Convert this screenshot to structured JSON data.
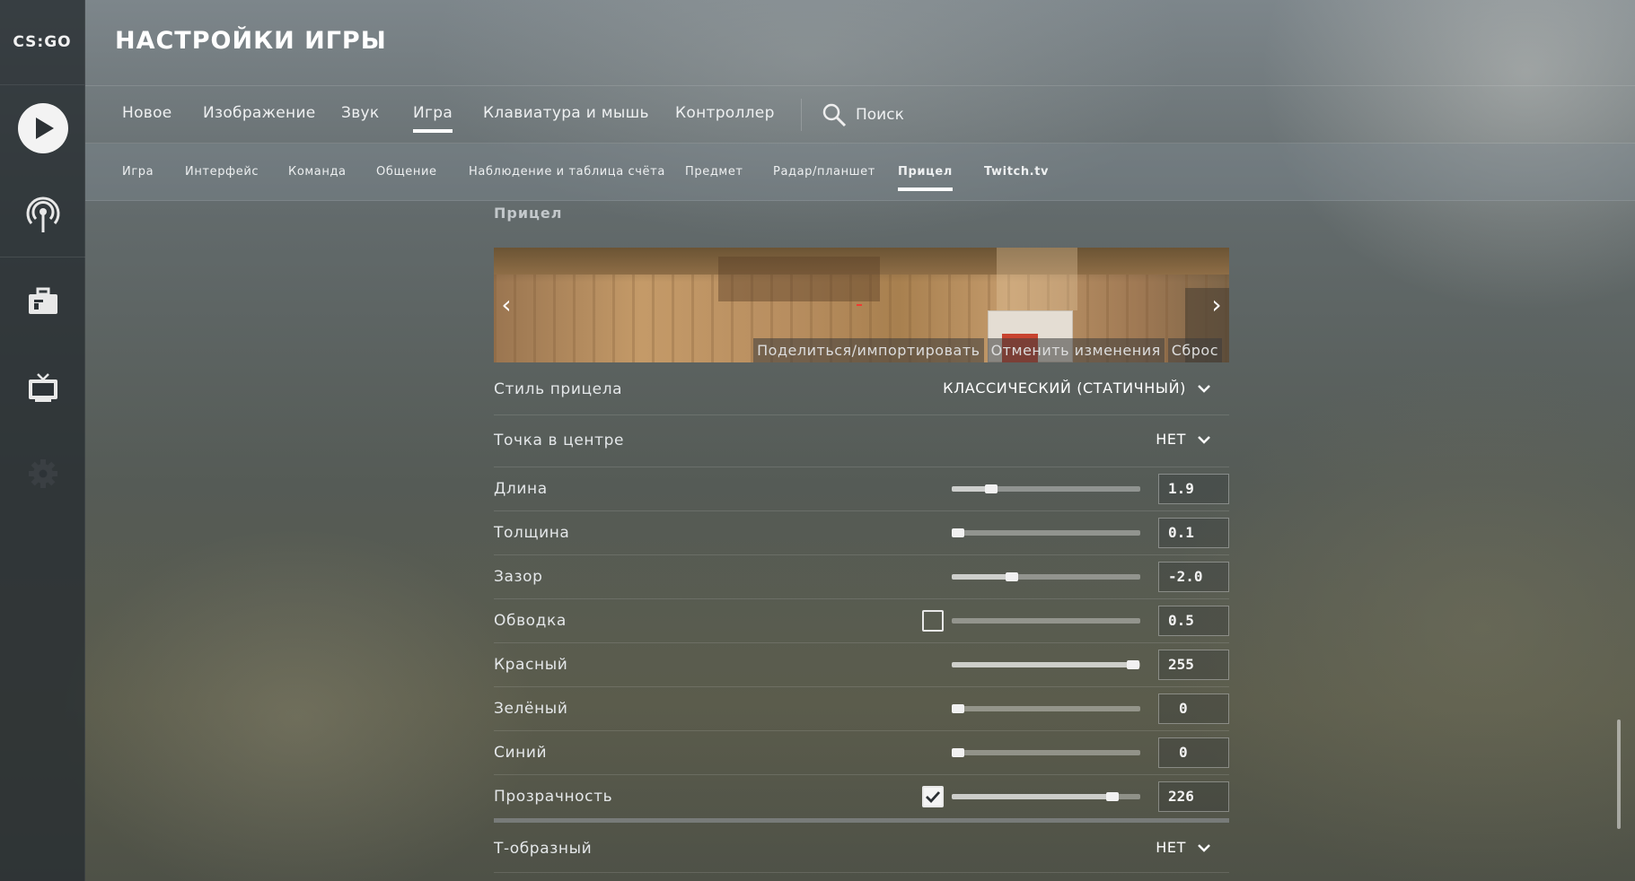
{
  "app": {
    "logo_text": "CS:GO",
    "title": "НАСТРОЙКИ ИГРЫ"
  },
  "sidebar": {
    "items": [
      {
        "name": "play",
        "icon": "play-icon"
      },
      {
        "name": "broadcast",
        "icon": "antenna-icon"
      },
      {
        "name": "inventory",
        "icon": "briefcase-icon"
      },
      {
        "name": "watch",
        "icon": "tv-icon"
      },
      {
        "name": "settings",
        "icon": "gear-icon"
      }
    ]
  },
  "main_tabs": [
    {
      "label": "Новое"
    },
    {
      "label": "Изображение"
    },
    {
      "label": "Звук"
    },
    {
      "label": "Игра",
      "active": true
    },
    {
      "label": "Клавиатура и мышь"
    },
    {
      "label": "Контроллер"
    }
  ],
  "search": {
    "label": "Поиск",
    "icon": "search-icon"
  },
  "sub_tabs": [
    {
      "label": "Игра"
    },
    {
      "label": "Интерфейс"
    },
    {
      "label": "Команда"
    },
    {
      "label": "Общение"
    },
    {
      "label": "Наблюдение и таблица счёта"
    },
    {
      "label": "Предмет"
    },
    {
      "label": "Радар/планшет"
    },
    {
      "label": "Прицел",
      "active": true
    },
    {
      "label": "Twitch.tv"
    }
  ],
  "section": {
    "title": "Прицел"
  },
  "preview": {
    "actions": [
      "Поделиться/импортировать",
      "Отменить изменения",
      "Сброс"
    ]
  },
  "settings": {
    "style": {
      "label": "Стиль прицела",
      "value": "КЛАССИЧЕСКИЙ (СТАТИЧНЫЙ)"
    },
    "center_dot": {
      "label": "Точка в центре",
      "value": "НЕТ"
    },
    "length": {
      "label": "Длина",
      "value": "1.9",
      "fraction": 0.21
    },
    "thickness": {
      "label": "Толщина",
      "value": "0.1",
      "fraction": 0.02
    },
    "gap": {
      "label": "Зазор",
      "value": "-2.0",
      "fraction": 0.32
    },
    "outline": {
      "label": "Обводка",
      "value": "0.5",
      "fraction": 0.0,
      "checked": false
    },
    "red": {
      "label": "Красный",
      "value": "255",
      "fraction": 0.96
    },
    "green": {
      "label": "Зелёный",
      "value": "0",
      "fraction": 0.02
    },
    "blue": {
      "label": "Синий",
      "value": "0",
      "fraction": 0.02
    },
    "alpha": {
      "label": "Прозрачность",
      "value": "226",
      "fraction": 0.85,
      "checked": true
    },
    "t_style": {
      "label": "Т-образный",
      "value": "НЕТ"
    }
  },
  "colors": {
    "accent": "#ffffff",
    "sidebar_bg": "#282e32"
  }
}
